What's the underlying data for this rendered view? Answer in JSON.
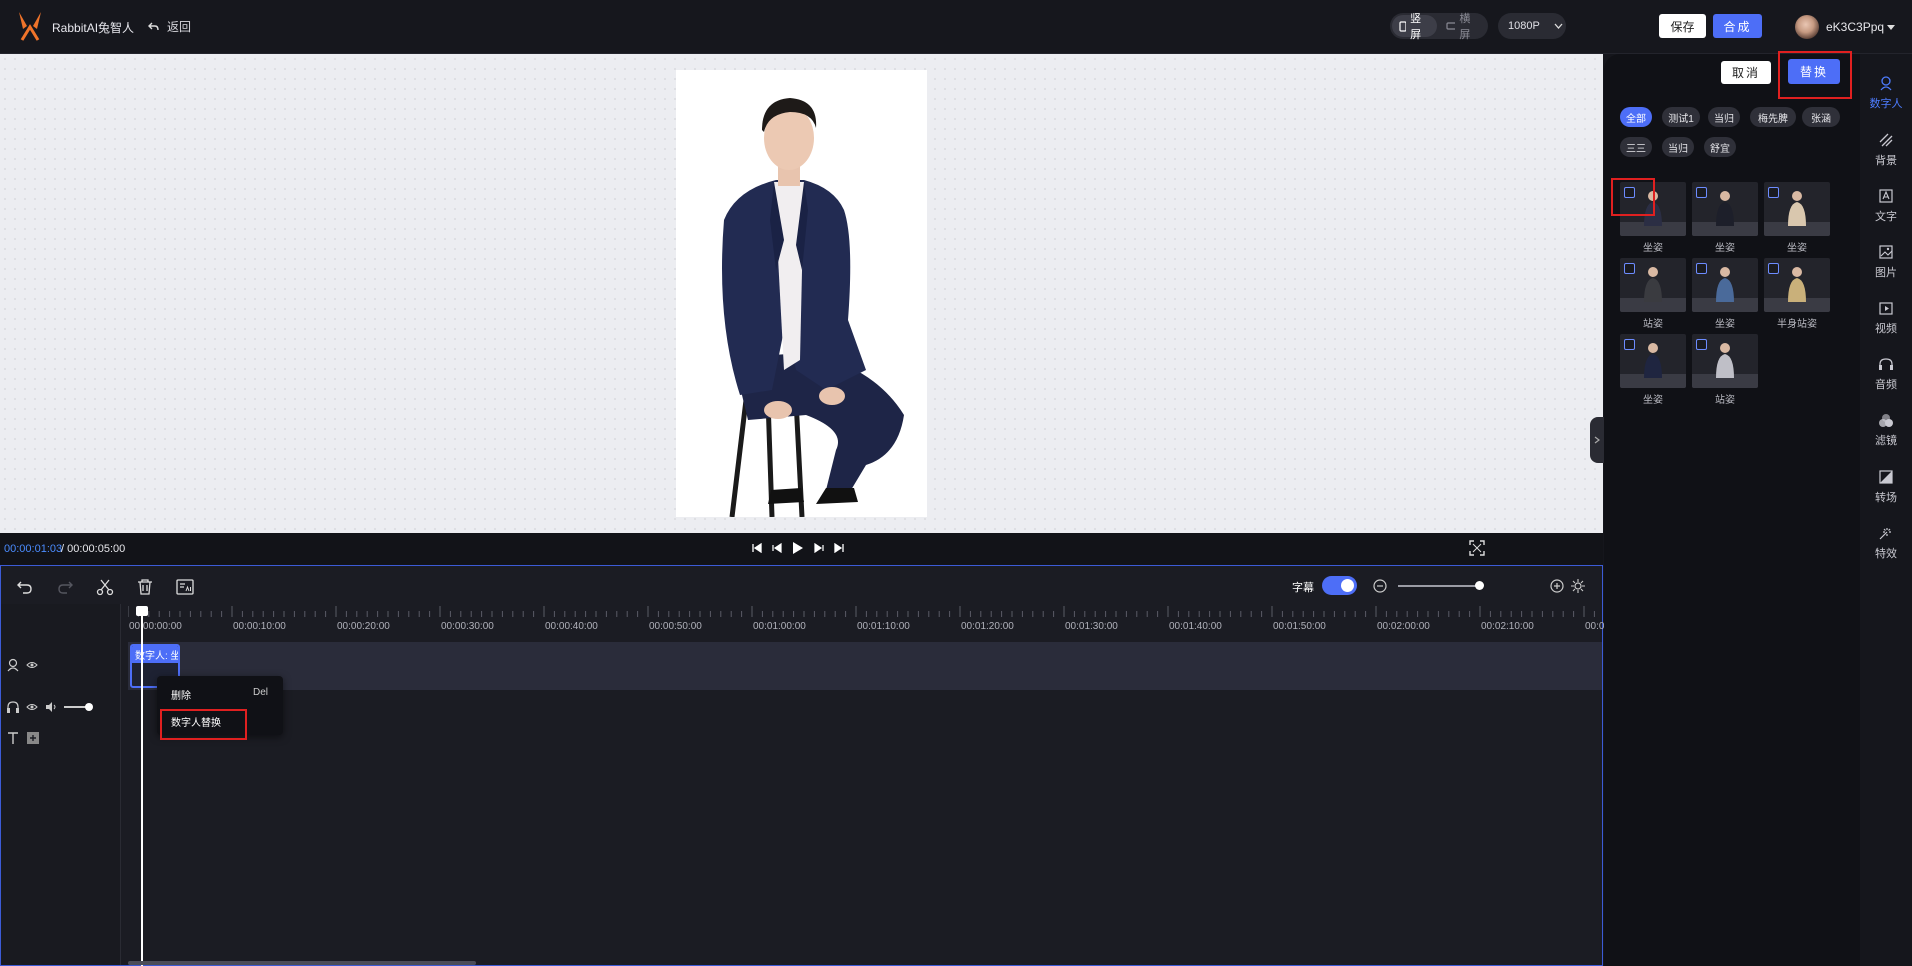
{
  "header": {
    "brand": "RabbitAI兔智人",
    "back_label": "返回",
    "orientation": [
      "竖屏",
      "横屏"
    ],
    "resolution": "1080P",
    "save_label": "保存",
    "compose_label": "合成",
    "username": "eK3C3Ppq"
  },
  "player": {
    "current_time": "00:00:01:03",
    "separator": "/",
    "total_time": "00:00:05:00"
  },
  "timeline": {
    "subtitle_label": "字幕",
    "subtitle_on": true,
    "ticks": [
      "00:00:00:00",
      "00:00:10:00",
      "00:00:20:00",
      "00:00:30:00",
      "00:00:40:00",
      "00:00:50:00",
      "00:01:00:00",
      "00:01:10:00",
      "00:01:20:00",
      "00:01:30:00",
      "00:01:40:00",
      "00:01:50:00",
      "00:02:00:00",
      "00:02:10:00",
      "00:0"
    ],
    "clip_label": "数字人: 坐",
    "context_menu": {
      "delete_label": "删除",
      "delete_shortcut": "Del",
      "replace_label": "数字人替换"
    }
  },
  "panel": {
    "cancel_label": "取消",
    "replace_label": "替换",
    "filters": [
      "全部",
      "测试1",
      "当归",
      "梅先脾",
      "张涵",
      "三三",
      "当归",
      "舒宜"
    ],
    "active_filter": 0,
    "avatars": [
      {
        "caption": "坐姿"
      },
      {
        "caption": "坐姿"
      },
      {
        "caption": "坐姿"
      },
      {
        "caption": "站姿"
      },
      {
        "caption": "坐姿"
      },
      {
        "caption": "半身站姿"
      },
      {
        "caption": "坐姿"
      },
      {
        "caption": "站姿"
      }
    ]
  },
  "rail": {
    "items": [
      "数字人",
      "背景",
      "文字",
      "图片",
      "视频",
      "音频",
      "滤镜",
      "转场",
      "特效"
    ],
    "active": 0
  },
  "colors": {
    "accent": "#4d6ef7",
    "highlight": "#e02020"
  }
}
